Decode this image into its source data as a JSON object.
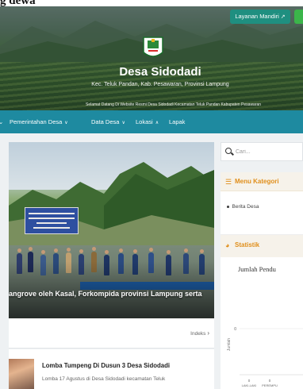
{
  "top_fragment": "g dewa",
  "header": {
    "layanan_button": "Layanan Mandiri",
    "layanan_icon": "external-link-icon",
    "title": "Desa Sidodadi",
    "subtitle": "Kec. Teluk Pandan, Kab. Pesawaran, Provinsi Lampung",
    "welcome": "Selamat Datang Di Website Resmi Desa Sidodadi Kecamatan Teluk Pandan Kabupaten Pesawaran"
  },
  "nav": {
    "items": [
      {
        "label": "Pemerintahan Desa",
        "caret": "chevron-down-icon"
      },
      {
        "label": "Data Desa",
        "caret": "chevron-down-icon"
      },
      {
        "label": "Lokasi",
        "caret": "chevron-up-icon"
      },
      {
        "label": "Lapak"
      }
    ]
  },
  "slider": {
    "caption": "angrove oleh Kasal, Forkompida provinsi Lampung serta"
  },
  "indeks": {
    "label": "Indeks",
    "icon": "chevron-right-icon"
  },
  "news": {
    "title": "Lomba Tumpeng Di Dusun 3 Desa Sidodadi",
    "excerpt": "Lomba 17 Agustus di Desa Sidodadi kecamatan Teluk"
  },
  "search": {
    "placeholder": "Cari..."
  },
  "menu_kategori": {
    "title": "Menu Kategori",
    "icon": "bars-icon",
    "items": [
      "Berita Desa"
    ]
  },
  "statistik": {
    "title": "Statistik",
    "icon": "pie-chart-icon"
  },
  "chart_data": {
    "type": "bar",
    "title": "Jumlah Pendu",
    "ylabel": "Jumlah",
    "categories": [
      "LAKI-LAKI",
      "PEREMPU"
    ],
    "series": [
      {
        "values": [
          0,
          0
        ]
      }
    ],
    "y_ticks": [
      "0"
    ],
    "grid": true
  },
  "colors": {
    "nav": "#1e8aa0",
    "layanan": "#1f8f80",
    "accent": "#e08e1a"
  }
}
